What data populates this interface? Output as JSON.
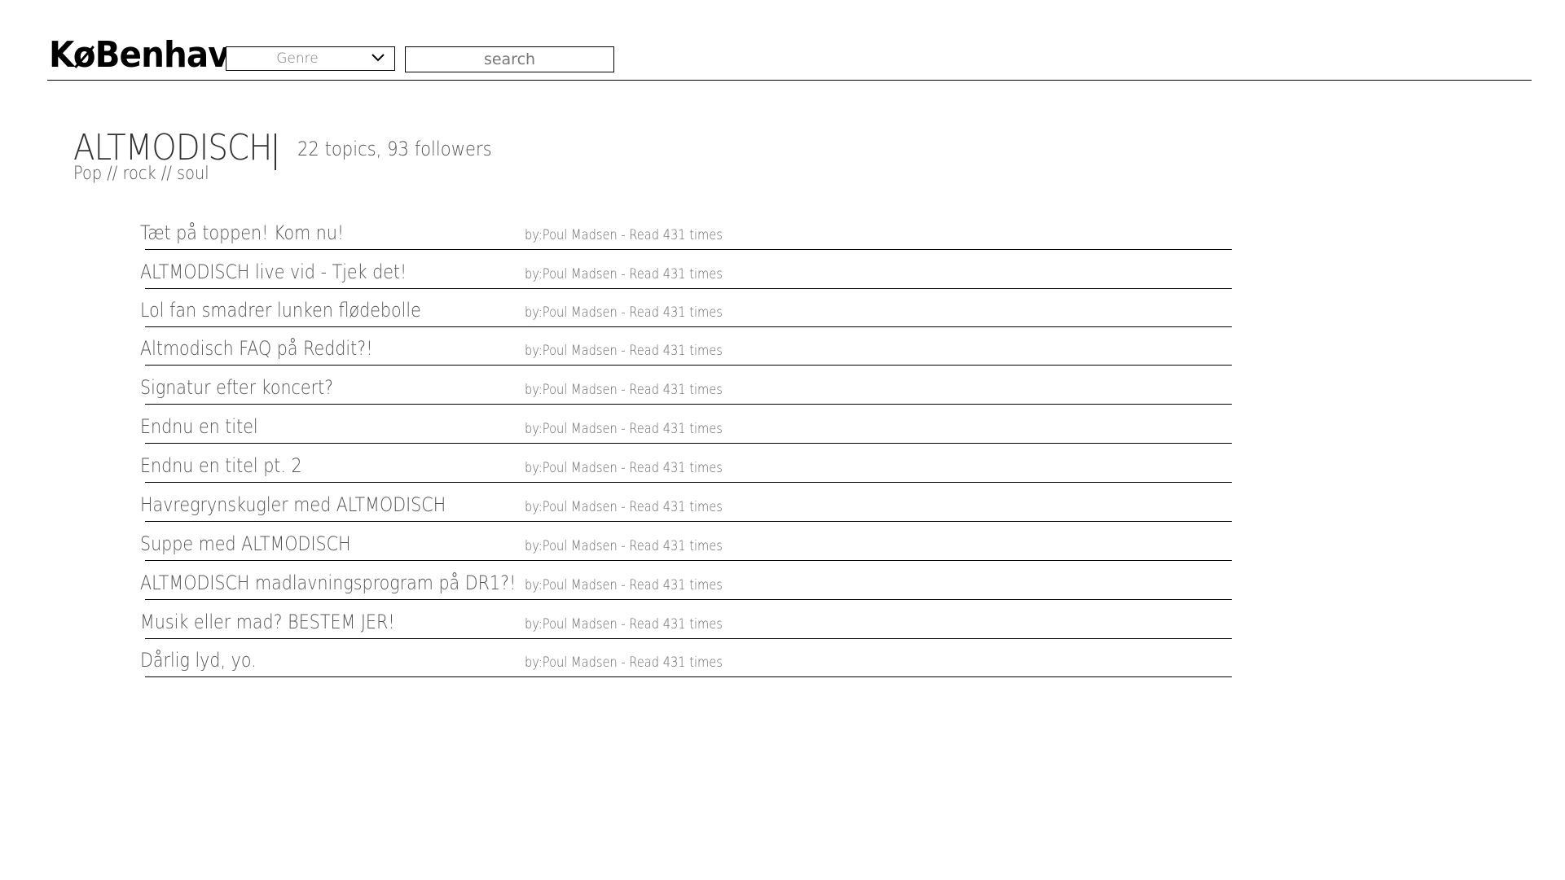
{
  "header": {
    "logo": "KøBenhavn",
    "genre_select": {
      "label": "Genre",
      "icon": "chevron-down-icon"
    },
    "search": {
      "placeholder": "search",
      "value": ""
    }
  },
  "forum": {
    "title": "ALTMODISCH",
    "stats": "22 topics, 93 followers",
    "genres": "Pop // rock // soul"
  },
  "topics": [
    {
      "title": "Tæt på toppen! Kom nu!",
      "meta": "by:Poul Madsen - Read 431 times"
    },
    {
      "title": "ALTMODISCH live vid - Tjek det!",
      "meta": "by:Poul Madsen - Read 431 times"
    },
    {
      "title": "Lol fan smadrer lunken flødebolle",
      "meta": "by:Poul Madsen - Read 431 times"
    },
    {
      "title": "Altmodisch FAQ på Reddit?!",
      "meta": "by:Poul Madsen - Read 431 times"
    },
    {
      "title": "Signatur efter koncert?",
      "meta": "by:Poul Madsen - Read 431 times"
    },
    {
      "title": "Endnu en titel",
      "meta": "by:Poul Madsen - Read 431 times"
    },
    {
      "title": "Endnu en titel pt. 2",
      "meta": "by:Poul Madsen - Read 431 times"
    },
    {
      "title": "Havregrynskugler med ALTMODISCH",
      "meta": "by:Poul Madsen - Read 431 times"
    },
    {
      "title": "Suppe med ALTMODISCH",
      "meta": "by:Poul Madsen - Read 431 times"
    },
    {
      "title": "ALTMODISCH madlavningsprogram på DR1?!",
      "meta": "by:Poul Madsen - Read 431 times"
    },
    {
      "title": "Musik eller mad? BESTEM JER!",
      "meta": "by:Poul Madsen - Read 431 times"
    },
    {
      "title": "Dårlig lyd, yo.",
      "meta": "by:Poul Madsen - Read 431 times"
    }
  ]
}
